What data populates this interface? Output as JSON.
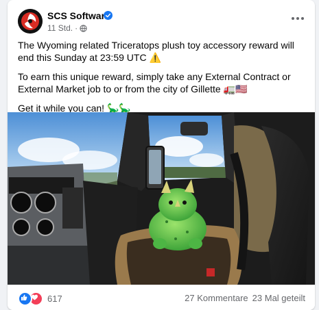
{
  "post": {
    "page_name": "SCS Software",
    "timestamp": "11 Std.",
    "separator": "·",
    "paragraph1": "The Wyoming related Triceratops plush toy accessory reward will end this Sunday at 23:59 UTC ⚠️",
    "paragraph2": "To earn this unique reward, simply take any External Contract or External Market job to or from the city of Gillette 🚛🇺🇸",
    "paragraph3": "Get it while you can! 🦕🦕"
  },
  "footer": {
    "reaction_count": "617",
    "comments": "27 Kommentare",
    "shares": "23 Mal geteilt"
  },
  "icons": {
    "verified": "verified-badge-icon",
    "privacy": "globe-icon",
    "more": "more-options-icon",
    "like": "like-reaction-icon",
    "love": "love-reaction-icon"
  },
  "colors": {
    "facebook_blue": "#1877f2",
    "love_red": "#f33e58",
    "secondary_text": "#65676b"
  }
}
